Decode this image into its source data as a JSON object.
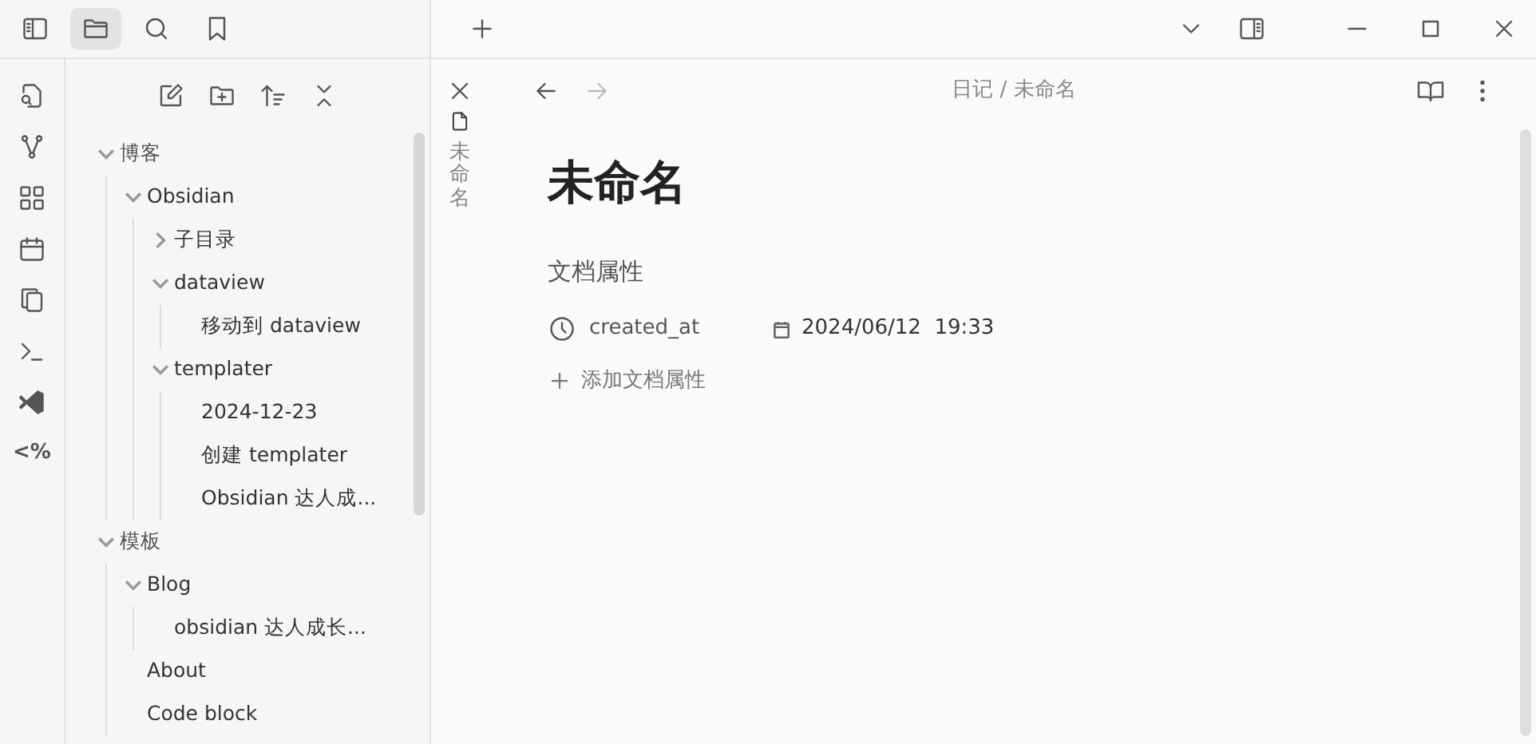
{
  "sidebar_tabs": [
    {
      "selected": true
    },
    {
      "selected": false
    },
    {
      "selected": false
    }
  ],
  "ribbon_label": "<%",
  "file_tree": [
    {
      "label": "博客",
      "expanded": true,
      "children": [
        {
          "label": "Obsidian",
          "expanded": true,
          "children": [
            {
              "label": "子目录",
              "expanded": false
            },
            {
              "label": "dataview",
              "expanded": true,
              "children": [
                {
                  "label": "移动到 dataview"
                }
              ]
            },
            {
              "label": "templater",
              "expanded": true,
              "children": [
                {
                  "label": "2024-12-23"
                },
                {
                  "label": "创建 templater"
                },
                {
                  "label": "Obsidian 达人成..."
                }
              ]
            }
          ]
        }
      ]
    },
    {
      "label": "模板",
      "expanded": true,
      "children": [
        {
          "label": "Blog",
          "expanded": true,
          "children": [
            {
              "label": "obsidian 达人成长..."
            }
          ]
        },
        {
          "label": "About"
        },
        {
          "label": "Code block"
        }
      ]
    }
  ],
  "stacked_tab": {
    "title": "未命名"
  },
  "breadcrumb": [
    "日记",
    "/",
    "未命名"
  ],
  "note": {
    "title": "未命名",
    "properties_heading": "文档属性",
    "properties": [
      {
        "key": "created_at",
        "value": "2024/06/12  19:33"
      }
    ],
    "add_property": "添加文档属性"
  }
}
